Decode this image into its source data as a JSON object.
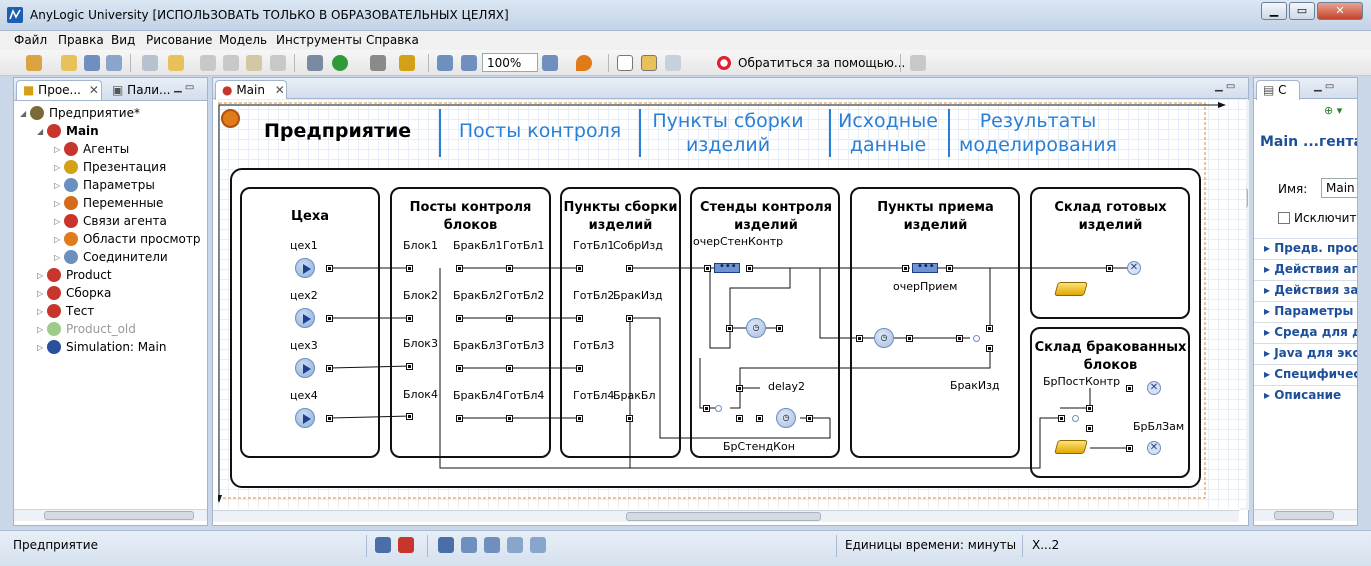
{
  "window": {
    "title": "AnyLogic University [ИСПОЛЬЗОВАТЬ ТОЛЬКО В ОБРАЗОВАТЕЛЬНЫХ ЦЕЛЯХ]",
    "min": "▁",
    "max": "▭",
    "close": "✕"
  },
  "menu": [
    "Файл",
    "Правка",
    "Вид",
    "Рисование",
    "Модель",
    "Инструменты",
    "Справка"
  ],
  "toolbar": {
    "zoom": "100%",
    "help": "Обратиться за помощью..."
  },
  "left_panel": {
    "tabs": [
      "Прое...",
      "Пали..."
    ],
    "tree": [
      {
        "label": "Предприятие*",
        "level": 0,
        "icon": "project-icon",
        "color": "#7a6a3a"
      },
      {
        "label": "Main",
        "level": 1,
        "icon": "agent-icon",
        "color": "#c8352c",
        "bold": true
      },
      {
        "label": "Агенты",
        "level": 2,
        "icon": "agents-icon",
        "color": "#c8352c"
      },
      {
        "label": "Презентация",
        "level": 2,
        "icon": "presentation-icon",
        "color": "#d4a017"
      },
      {
        "label": "Параметры",
        "level": 2,
        "icon": "parameters-icon",
        "color": "#6b8fbf"
      },
      {
        "label": "Переменные",
        "level": 2,
        "icon": "variables-icon",
        "color": "#d46a1a"
      },
      {
        "label": "Связи агента",
        "level": 2,
        "icon": "links-icon",
        "color": "#c8352c"
      },
      {
        "label": "Области просмотр",
        "level": 2,
        "icon": "viewarea-icon",
        "color": "#e07b1a"
      },
      {
        "label": "Соединители",
        "level": 2,
        "icon": "connectors-icon",
        "color": "#6b8fbf"
      },
      {
        "label": "Product",
        "level": 1,
        "icon": "agent-icon",
        "color": "#c8352c"
      },
      {
        "label": "Сборка",
        "level": 1,
        "icon": "agent-icon",
        "color": "#c8352c"
      },
      {
        "label": "Тест",
        "level": 1,
        "icon": "agent-icon",
        "color": "#c8352c"
      },
      {
        "label": "Product_old",
        "level": 1,
        "icon": "agent-icon",
        "color": "#9ccc8a",
        "dim": true
      },
      {
        "label": "Simulation: Main",
        "level": 1,
        "icon": "experiment-icon",
        "color": "#2a4f9c"
      }
    ]
  },
  "editor": {
    "tab": "Main",
    "title": "Предприятие",
    "headers": [
      "Посты контроля",
      "Пункты сборки изделий",
      "Исходные данные",
      "Результаты моделирования"
    ],
    "blocks": [
      {
        "title": "Цеха"
      },
      {
        "title": "Посты контроля блоков"
      },
      {
        "title": "Пункты сборки изделий"
      },
      {
        "title": "Стенды контроля изделий"
      },
      {
        "title": "Пункты приема изделий"
      },
      {
        "title": "Склад готовых изделий"
      },
      {
        "title": "Склад бракованных блоков"
      }
    ],
    "labels": {
      "workshops": [
        "цех1",
        "цех2",
        "цех3",
        "цех4"
      ],
      "blocks": [
        "Блок1",
        "Блок2",
        "Блок3",
        "Блок4"
      ],
      "defects": [
        "БракБл1",
        "БракБл2",
        "БракБл3",
        "БракБл4"
      ],
      "ready": [
        "ГотБл1",
        "ГотБл2",
        "ГотБл3",
        "ГотБл4"
      ],
      "ready2": [
        "ГотБл1",
        "ГотБл2",
        "ГотБл3",
        "ГотБл4"
      ],
      "assembled": "СобрИзд",
      "assembly_defect": "БракИзд",
      "bad_block": "БракБл",
      "stand_queue": "очерСтенКонтр",
      "delay2": "delay2",
      "stand_defect": "БрСтендКон",
      "receive_queue": "очерПрием",
      "receive_defect": "БракИзд",
      "defect_post": "БрПостКонтр",
      "block_replace": "БрБлЗам"
    }
  },
  "right_panel": {
    "tab": "С",
    "title": "Main ...гента",
    "name_label": "Имя:",
    "name_value": "Main",
    "exclude_label": "Исключить",
    "sections": [
      "Предв. просм",
      "Действия аге",
      "Действия зая",
      "Параметры ди",
      "Среда для дру",
      "Java для экспе",
      "Специфически",
      "Описание"
    ]
  },
  "status": {
    "project": "Предприятие",
    "time_units": "Единицы времени: минуты",
    "coords": "X...2"
  }
}
